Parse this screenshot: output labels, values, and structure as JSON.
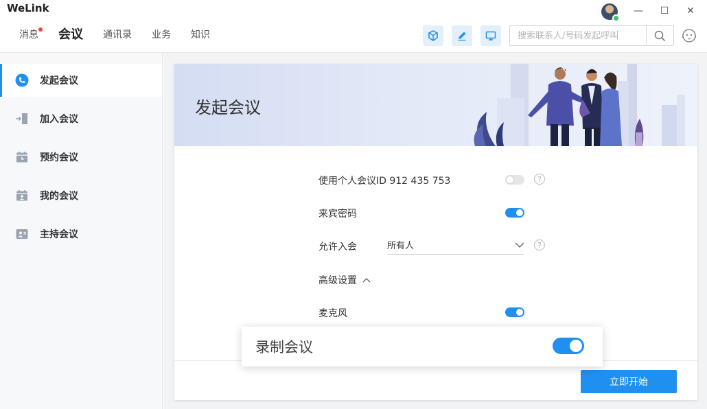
{
  "app": {
    "title": "WeLink"
  },
  "window_controls": {
    "minimize": "—",
    "maximize": "☐",
    "close": "✕"
  },
  "nav": {
    "items": [
      {
        "label": "消息",
        "has_badge": true
      },
      {
        "label": "会议",
        "active": true
      },
      {
        "label": "通讯录"
      },
      {
        "label": "业务"
      },
      {
        "label": "知识"
      }
    ]
  },
  "toolbar": {
    "icons": [
      "cube-icon",
      "pen-icon",
      "screen-share-icon"
    ]
  },
  "search": {
    "placeholder": "搜索联系人/号码发起呼叫",
    "value": ""
  },
  "sidebar": {
    "items": [
      {
        "label": "发起会议",
        "icon": "phone-call-icon",
        "active": true
      },
      {
        "label": "加入会议",
        "icon": "enter-door-icon"
      },
      {
        "label": "预约会议",
        "icon": "calendar-clock-icon"
      },
      {
        "label": "我的会议",
        "icon": "calendar-person-icon"
      },
      {
        "label": "主持会议",
        "icon": "host-icon"
      }
    ]
  },
  "main": {
    "banner_title": "发起会议",
    "settings": {
      "personal_id_label": "使用个人会议ID 912 435 753",
      "personal_id_enabled": false,
      "guest_password_label": "来宾密码",
      "guest_password_enabled": true,
      "allow_join_label": "允许入会",
      "allow_join_value": "所有人",
      "advanced_label": "高级设置",
      "microphone_label": "麦克风",
      "microphone_enabled": true,
      "record_label": "录制会议",
      "record_enabled": true
    },
    "start_button": "立即开始"
  },
  "colors": {
    "accent": "#1f8ff0",
    "badge": "#f44336",
    "online": "#3cbf6a"
  }
}
